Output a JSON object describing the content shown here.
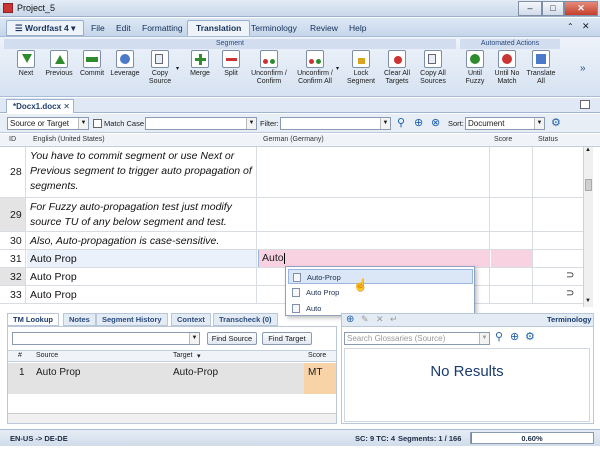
{
  "window": {
    "title": "Project_5"
  },
  "menu": {
    "app_label": "Wordfast 4",
    "tabs": [
      "File",
      "Edit",
      "Formatting",
      "Translation",
      "Terminology",
      "Review",
      "Help"
    ],
    "active_tab": "Translation"
  },
  "ribbon": {
    "group_segment": "Segment",
    "group_automated": "Automated Actions",
    "buttons": [
      {
        "label": "Next"
      },
      {
        "label": "Previous"
      },
      {
        "label": "Commit"
      },
      {
        "label": "Leverage"
      },
      {
        "label": "Copy Source"
      },
      {
        "label": "Merge"
      },
      {
        "label": "Split"
      },
      {
        "label": "Unconfirm / Confirm"
      },
      {
        "label": "Unconfirm / Confirm All"
      },
      {
        "label": "Lock Segment"
      },
      {
        "label": "Clear All Targets"
      },
      {
        "label": "Copy All Sources"
      },
      {
        "label": "Until Fuzzy"
      },
      {
        "label": "Until No Match"
      },
      {
        "label": "Translate All"
      }
    ],
    "expand": "»"
  },
  "doc_tab": {
    "label": "*Docx1.docx"
  },
  "filter": {
    "scope": "Source or Target",
    "match_case": "Match Case",
    "filter_label": "Filter:",
    "sort_label": "Sort:",
    "sort_value": "Document"
  },
  "grid": {
    "headers": {
      "id": "ID",
      "source": "English (United States)",
      "target": "German (Germany)",
      "score": "Score",
      "status": "Status"
    },
    "rows": [
      {
        "id": "28",
        "source": "You have to commit segment or use Next or Previous segment to trigger auto propagation of segments.",
        "target": "",
        "italic": true
      },
      {
        "id": "29",
        "source": "For Fuzzy auto-propagation test just modify source TU of any below segment and test.",
        "target": "",
        "italic": true
      },
      {
        "id": "30",
        "source": "Also, Auto-propagation is case-sensitive.",
        "target": "",
        "italic": true
      },
      {
        "id": "31",
        "source": "Auto Prop",
        "target": "Auto",
        "italic": false
      },
      {
        "id": "32",
        "source": "Auto Prop",
        "target": "",
        "italic": false
      },
      {
        "id": "33",
        "source": "Auto Prop",
        "target": "",
        "italic": false
      }
    ]
  },
  "autosuggest": [
    "Auto-Prop",
    "Auto Prop",
    "Auto"
  ],
  "lower_tabs": [
    "TM Lookup",
    "Notes",
    "Segment History",
    "Context",
    "Transcheck (0)"
  ],
  "tm_lookup": {
    "find_source": "Find Source",
    "find_target": "Find Target",
    "headers": {
      "num": "#",
      "source": "Source",
      "target": "Target",
      "score": "Score"
    },
    "rows": [
      {
        "num": "1",
        "source": "Auto Prop",
        "target": "Auto-Prop",
        "score": "MT"
      }
    ]
  },
  "terminology": {
    "title": "Terminology",
    "search_placeholder": "Search Glossaries (Source)",
    "empty": "No Results"
  },
  "status": {
    "lang": "EN-US -> DE-DE",
    "sc": "SC: 9 TC: 4",
    "segments": "Segments: 1 / 166",
    "progress": "0.60%",
    "progress_value": 0.006
  }
}
